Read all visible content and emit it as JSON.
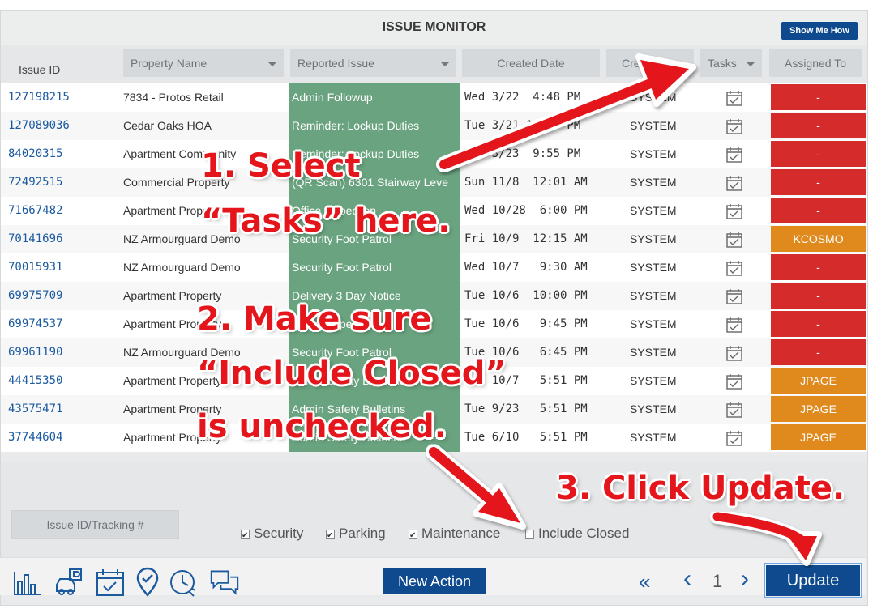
{
  "title": "ISSUE MONITOR",
  "show_me_how": "Show Me How",
  "headers": {
    "issue_id": "Issue ID",
    "property_name": "Property Name",
    "reported_issue": "Reported Issue",
    "created_date": "Created Date",
    "created_by": "Created By",
    "tasks": "Tasks",
    "assigned_to": "Assigned To"
  },
  "rows": [
    {
      "id": "127198215",
      "property": "7834 - Protos Retail",
      "issue": "Admin Followup",
      "date": "Wed 3/22  4:48 PM",
      "by": "SYSTEM",
      "assigned": "-",
      "assigned_color": "#d62b2b"
    },
    {
      "id": "127089036",
      "property": "Cedar Oaks HOA",
      "issue": "Reminder: Lockup Duties",
      "date": "Tue 3/21 11:30 PM",
      "by": "SYSTEM",
      "assigned": "-",
      "assigned_color": "#d62b2b"
    },
    {
      "id": "84020315",
      "property": "Apartment Community",
      "issue": "Reminder: Lockup Duties",
      "date": "Thu 3/23  9:55 PM",
      "by": "SYSTEM",
      "assigned": "-",
      "assigned_color": "#d62b2b"
    },
    {
      "id": "72492515",
      "property": "Commercial Property",
      "issue": "(QR Scan) 6301 Stairway Leve",
      "date": "Sun 11/8  12:01 AM",
      "by": "SYSTEM",
      "assigned": "-",
      "assigned_color": "#d62b2b"
    },
    {
      "id": "71667482",
      "property": "Apartment Property",
      "issue": "Office Inspection",
      "date": "Wed 10/28  6:00 PM",
      "by": "SYSTEM",
      "assigned": "-",
      "assigned_color": "#d62b2b"
    },
    {
      "id": "70141696",
      "property": "NZ Armourguard Demo",
      "issue": "Security Foot Patrol",
      "date": "Fri 10/9  12:15 AM",
      "by": "SYSTEM",
      "assigned": "KCOSMO",
      "assigned_color": "#e08a1e"
    },
    {
      "id": "70015931",
      "property": "NZ Armourguard Demo",
      "issue": "Security Foot Patrol",
      "date": "Wed 10/7   9:30 AM",
      "by": "SYSTEM",
      "assigned": "-",
      "assigned_color": "#d62b2b"
    },
    {
      "id": "69975709",
      "property": "Apartment Property",
      "issue": "Delivery 3 Day Notice",
      "date": "Tue 10/6  10:00 PM",
      "by": "SYSTEM",
      "assigned": "-",
      "assigned_color": "#d62b2b"
    },
    {
      "id": "69974537",
      "property": "Apartment Property",
      "issue": "Office Inspection",
      "date": "Tue 10/6   9:45 PM",
      "by": "SYSTEM",
      "assigned": "-",
      "assigned_color": "#d62b2b"
    },
    {
      "id": "69961190",
      "property": "NZ Armourguard Demo",
      "issue": "Security Foot Patrol",
      "date": "Tue 10/6   6:45 PM",
      "by": "SYSTEM",
      "assigned": "-",
      "assigned_color": "#d62b2b"
    },
    {
      "id": "44415350",
      "property": "Apartment Property",
      "issue": "Admin Safety Bulletins",
      "date": "Tue 10/7   5:51 PM",
      "by": "SYSTEM",
      "assigned": "JPAGE",
      "assigned_color": "#e08a1e"
    },
    {
      "id": "43575471",
      "property": "Apartment Property",
      "issue": "Admin Safety Bulletins",
      "date": "Tue 9/23   5:51 PM",
      "by": "SYSTEM",
      "assigned": "JPAGE",
      "assigned_color": "#e08a1e"
    },
    {
      "id": "37744604",
      "property": "Apartment Property",
      "issue": "Admin Safety Bulletins",
      "date": "Tue 6/10   5:51 PM",
      "by": "SYSTEM",
      "assigned": "JPAGE",
      "assigned_color": "#e08a1e"
    }
  ],
  "filters": {
    "tracking_placeholder": "Issue ID/Tracking #",
    "security": "Security",
    "parking": "Parking",
    "maintenance": "Maintenance",
    "include_closed": "Include Closed"
  },
  "footer": {
    "new_action": "New Action",
    "first_page": "«",
    "prev_page": "‹",
    "page": "1",
    "next_page": "›",
    "update": "Update"
  },
  "annotations": {
    "step1_line1": "1. Select",
    "step1_line2": "“Tasks” here.",
    "step2_line1": "2. Make sure",
    "step2_line2": "“Include Closed”",
    "step2_line3": "is unchecked.",
    "step3": "3. Click Update."
  },
  "colors": {
    "accent": "#104a8e",
    "issue_green": "#6aa37f",
    "unassigned_red": "#d62b2b",
    "assigned_orange": "#e08a1e",
    "annotation_red": "#e4161b"
  }
}
